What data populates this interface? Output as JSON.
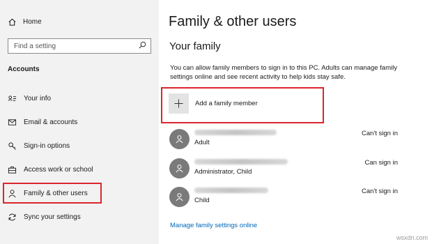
{
  "sidebar": {
    "home_label": "Home",
    "search_placeholder": "Find a setting",
    "section_title": "Accounts",
    "items": [
      {
        "label": "Your info",
        "icon": "your-info-icon"
      },
      {
        "label": "Email & accounts",
        "icon": "mail-icon"
      },
      {
        "label": "Sign-in options",
        "icon": "key-icon"
      },
      {
        "label": "Access work or school",
        "icon": "briefcase-icon"
      },
      {
        "label": "Family & other users",
        "icon": "person-icon",
        "selected": true
      },
      {
        "label": "Sync your settings",
        "icon": "sync-icon"
      }
    ]
  },
  "main": {
    "title": "Family & other users",
    "subtitle": "Your family",
    "description": "You can allow family members to sign in to this PC. Adults can manage family settings online and see recent activity to help kids stay safe.",
    "add_member_label": "Add a family member",
    "members": [
      {
        "role": "Adult",
        "status": "Can't sign in"
      },
      {
        "role": "Administrator, Child",
        "status": "Can sign in"
      },
      {
        "role": "Child",
        "status": "Can't sign in"
      }
    ],
    "manage_link": "Manage family settings online"
  },
  "watermark": "wsxdn.com",
  "colors": {
    "sidebar_bg": "#f2f2f2",
    "highlight_border": "#d9262b",
    "link": "#0067b8",
    "avatar": "#7a7a7a"
  }
}
